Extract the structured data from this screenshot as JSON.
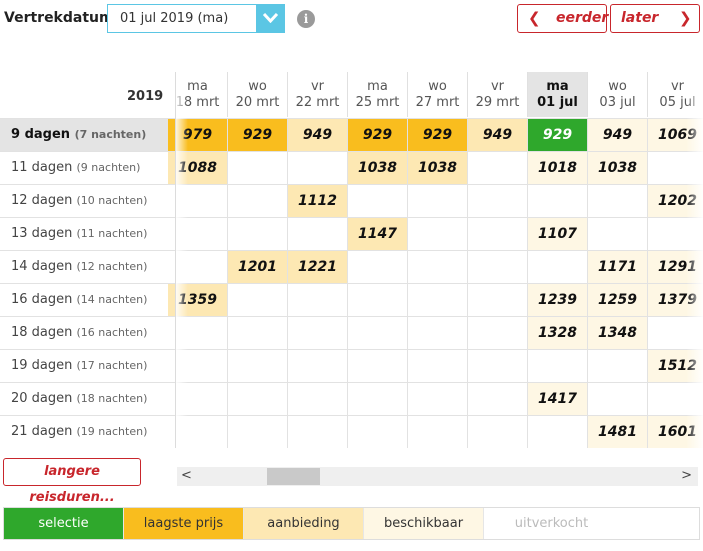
{
  "topbar": {
    "label": "Vertrekdatum",
    "date_value": "01 jul 2019 (ma)",
    "info": "i",
    "prev_label": "eerder",
    "next_label": "later"
  },
  "year": "2019",
  "columns": [
    {
      "day": "ma",
      "date": "18 mrt"
    },
    {
      "day": "wo",
      "date": "20 mrt"
    },
    {
      "day": "vr",
      "date": "22 mrt"
    },
    {
      "day": "ma",
      "date": "25 mrt"
    },
    {
      "day": "wo",
      "date": "27 mrt"
    },
    {
      "day": "vr",
      "date": "29 mrt"
    },
    {
      "day": "ma",
      "date": "01 jul",
      "selected": true
    },
    {
      "day": "wo",
      "date": "03 jul"
    },
    {
      "day": "vr",
      "date": "05 jul"
    }
  ],
  "rows": [
    {
      "days": "9 dagen",
      "nights": "(7 nachten)",
      "selected": true,
      "cells": [
        [
          "979",
          "low"
        ],
        [
          "929",
          "low"
        ],
        [
          "949",
          "off"
        ],
        [
          "929",
          "low"
        ],
        [
          "929",
          "low"
        ],
        [
          "949",
          "off"
        ],
        [
          "929",
          "sel"
        ],
        [
          "949",
          "ava"
        ],
        [
          "1069",
          "ava"
        ]
      ]
    },
    {
      "days": "11 dagen",
      "nights": "(9 nachten)",
      "cells": [
        [
          "1088",
          "off"
        ],
        [
          "",
          ""
        ],
        [
          "",
          ""
        ],
        [
          "1038",
          "off"
        ],
        [
          "1038",
          "off"
        ],
        [
          "",
          ""
        ],
        [
          "1018",
          "ava"
        ],
        [
          "1038",
          "ava"
        ],
        [
          "",
          ""
        ]
      ]
    },
    {
      "days": "12 dagen",
      "nights": "(10 nachten)",
      "cells": [
        [
          "",
          ""
        ],
        [
          "",
          ""
        ],
        [
          "1112",
          "off"
        ],
        [
          "",
          ""
        ],
        [
          "",
          ""
        ],
        [
          "",
          ""
        ],
        [
          "",
          ""
        ],
        [
          "",
          ""
        ],
        [
          "1202",
          "ava"
        ]
      ]
    },
    {
      "days": "13 dagen",
      "nights": "(11 nachten)",
      "cells": [
        [
          "",
          ""
        ],
        [
          "",
          ""
        ],
        [
          "",
          ""
        ],
        [
          "1147",
          "off"
        ],
        [
          "",
          ""
        ],
        [
          "",
          ""
        ],
        [
          "1107",
          "ava"
        ],
        [
          "",
          ""
        ],
        [
          "",
          ""
        ]
      ]
    },
    {
      "days": "14 dagen",
      "nights": "(12 nachten)",
      "cells": [
        [
          "",
          ""
        ],
        [
          "1201",
          "off"
        ],
        [
          "1221",
          "off"
        ],
        [
          "",
          ""
        ],
        [
          "",
          ""
        ],
        [
          "",
          ""
        ],
        [
          "",
          ""
        ],
        [
          "1171",
          "ava"
        ],
        [
          "1291",
          "ava"
        ]
      ]
    },
    {
      "days": "16 dagen",
      "nights": "(14 nachten)",
      "cells": [
        [
          "1359",
          "off"
        ],
        [
          "",
          ""
        ],
        [
          "",
          ""
        ],
        [
          "",
          ""
        ],
        [
          "",
          ""
        ],
        [
          "",
          ""
        ],
        [
          "1239",
          "ava"
        ],
        [
          "1259",
          "ava"
        ],
        [
          "1379",
          "ava"
        ]
      ]
    },
    {
      "days": "18 dagen",
      "nights": "(16 nachten)",
      "cells": [
        [
          "",
          ""
        ],
        [
          "",
          ""
        ],
        [
          "",
          ""
        ],
        [
          "",
          ""
        ],
        [
          "",
          ""
        ],
        [
          "",
          ""
        ],
        [
          "1328",
          "ava"
        ],
        [
          "1348",
          "ava"
        ],
        [
          "",
          ""
        ]
      ]
    },
    {
      "days": "19 dagen",
      "nights": "(17 nachten)",
      "cells": [
        [
          "",
          ""
        ],
        [
          "",
          ""
        ],
        [
          "",
          ""
        ],
        [
          "",
          ""
        ],
        [
          "",
          ""
        ],
        [
          "",
          ""
        ],
        [
          "",
          ""
        ],
        [
          "",
          ""
        ],
        [
          "1512",
          "ava"
        ]
      ]
    },
    {
      "days": "20 dagen",
      "nights": "(18 nachten)",
      "cells": [
        [
          "",
          ""
        ],
        [
          "",
          ""
        ],
        [
          "",
          ""
        ],
        [
          "",
          ""
        ],
        [
          "",
          ""
        ],
        [
          "",
          ""
        ],
        [
          "1417",
          "ava"
        ],
        [
          "",
          ""
        ],
        [
          "",
          ""
        ]
      ]
    },
    {
      "days": "21 dagen",
      "nights": "(19 nachten)",
      "cells": [
        [
          "",
          ""
        ],
        [
          "",
          ""
        ],
        [
          "",
          ""
        ],
        [
          "",
          ""
        ],
        [
          "",
          ""
        ],
        [
          "",
          ""
        ],
        [
          "",
          ""
        ],
        [
          "1481",
          "ava"
        ],
        [
          "1601",
          "ava"
        ]
      ]
    }
  ],
  "longer_label": "langere reisduren...",
  "scroll_left": "<",
  "scroll_right": ">",
  "legend": [
    {
      "label": "selectie",
      "color": "#2fa82c",
      "text_color": "#ffffff"
    },
    {
      "label": "laagste prijs",
      "color": "#f9bd1e",
      "text_color": "#333333"
    },
    {
      "label": "aanbieding",
      "color": "#fde8b3",
      "text_color": "#333333"
    },
    {
      "label": "beschikbaar",
      "color": "#fef7e4",
      "text_color": "#333333"
    },
    {
      "label": "uitverkocht",
      "color": "#ffffff",
      "text_color": "#bbbbbb"
    }
  ]
}
